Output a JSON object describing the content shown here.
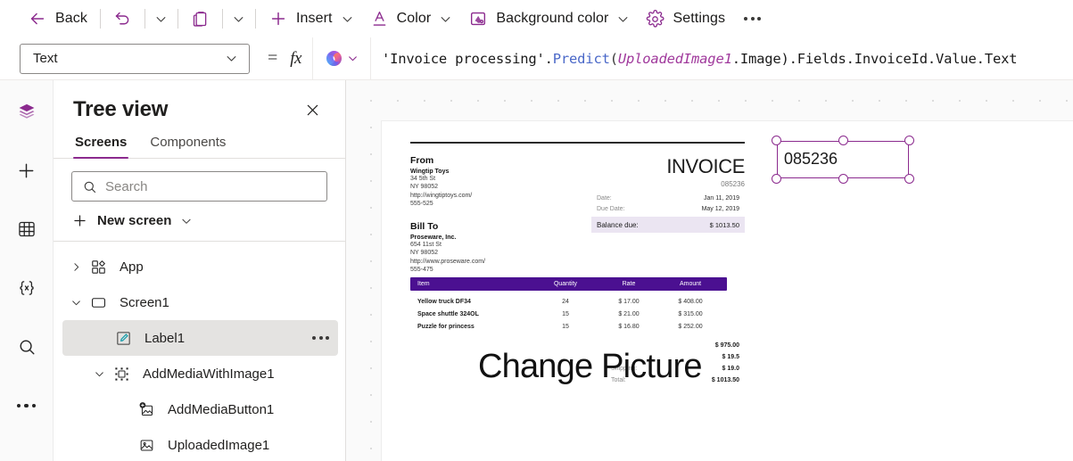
{
  "toolbar": {
    "back_label": "Back",
    "undo_icon": "undo-icon",
    "paste_icon": "paste-icon",
    "insert_label": "Insert",
    "color_label": "Color",
    "background_color_label": "Background color",
    "settings_label": "Settings",
    "overflow_label": "More commands"
  },
  "formula_bar": {
    "property": "Text",
    "equals": "=",
    "fx": "fx",
    "copilot_icon": "copilot-icon",
    "formula_parts": {
      "string": "'Invoice processing'",
      "dot1": ".",
      "function": "Predict",
      "open_paren": "(",
      "variable": "UploadedImage1",
      "tail": ".Image)",
      "rest": ".Fields.InvoiceId.Value.Text"
    },
    "formula_full": "'Invoice processing'.Predict(UploadedImage1.Image).Fields.InvoiceId.Value.Text"
  },
  "rail": {
    "items": [
      {
        "name": "tree-view",
        "icon": "layers-icon",
        "active": true
      },
      {
        "name": "insert",
        "icon": "plus-icon",
        "active": false
      },
      {
        "name": "data",
        "icon": "table-icon",
        "active": false
      },
      {
        "name": "variables",
        "icon": "braces-x-icon",
        "active": false
      },
      {
        "name": "search",
        "icon": "search-icon",
        "active": false
      },
      {
        "name": "more",
        "icon": "ellipsis-icon",
        "active": false
      }
    ]
  },
  "tree_panel": {
    "title": "Tree view",
    "close_icon": "close-icon",
    "tabs": [
      {
        "label": "Screens",
        "active": true
      },
      {
        "label": "Components",
        "active": false
      }
    ],
    "search_placeholder": "Search",
    "search_value": "",
    "new_screen_label": "New screen",
    "items": [
      {
        "label": "App",
        "icon": "app-icon",
        "caret": "collapsed",
        "indent": 0,
        "selected": false
      },
      {
        "label": "Screen1",
        "icon": "screen-icon",
        "caret": "expanded",
        "indent": 0,
        "selected": false
      },
      {
        "label": "Label1",
        "icon": "label-icon",
        "caret": "none",
        "indent": 1,
        "selected": true
      },
      {
        "label": "AddMediaWithImage1",
        "icon": "group-icon",
        "caret": "expanded",
        "indent": 1,
        "selected": false
      },
      {
        "label": "AddMediaButton1",
        "icon": "add-media-icon",
        "caret": "none",
        "indent": 2,
        "selected": false
      },
      {
        "label": "UploadedImage1",
        "icon": "image-icon",
        "caret": "none",
        "indent": 2,
        "selected": false
      }
    ]
  },
  "canvas": {
    "selected_label_text": "085236",
    "change_picture_text": "Change Picture",
    "accent_color": "#8b2a8e",
    "invoice": {
      "rule": true,
      "from_heading": "From",
      "from_name": "Wingtip Toys",
      "from_lines": [
        "34 5th St",
        "NY 98052",
        "http://wingtiptoys.com/",
        "555-525"
      ],
      "title": "INVOICE",
      "number": "085236",
      "billto_heading": "Bill To",
      "billto_name": "Proseware, Inc.",
      "billto_lines": [
        "654 11st St",
        "NY 98052",
        "http://www.proseware.com/",
        "555-475"
      ],
      "meta": [
        {
          "key": "Date:",
          "value": "Jan 11, 2019"
        },
        {
          "key": "Due Date:",
          "value": "May 12, 2019"
        }
      ],
      "balance": {
        "key": "Balance due:",
        "value": "$ 1013.50"
      },
      "table_headers": [
        "Item",
        "Quantity",
        "Rate",
        "Amount"
      ],
      "line_items": [
        {
          "item": "Yellow truck DF34",
          "quantity": "24",
          "rate": "$ 17.00",
          "amount": "$ 408.00"
        },
        {
          "item": "Space shuttle 324OL",
          "quantity": "15",
          "rate": "$ 21.00",
          "amount": "$ 315.00"
        },
        {
          "item": "Puzzle for princess",
          "quantity": "15",
          "rate": "$ 16.80",
          "amount": "$ 252.00"
        }
      ],
      "totals": [
        {
          "key": "",
          "value": "$ 975.00"
        },
        {
          "key": "",
          "value": "$ 19.5"
        },
        {
          "key": "Shipping:",
          "value": "$ 19.0"
        },
        {
          "key": "Total:",
          "value": "$ 1013.50"
        }
      ]
    }
  }
}
